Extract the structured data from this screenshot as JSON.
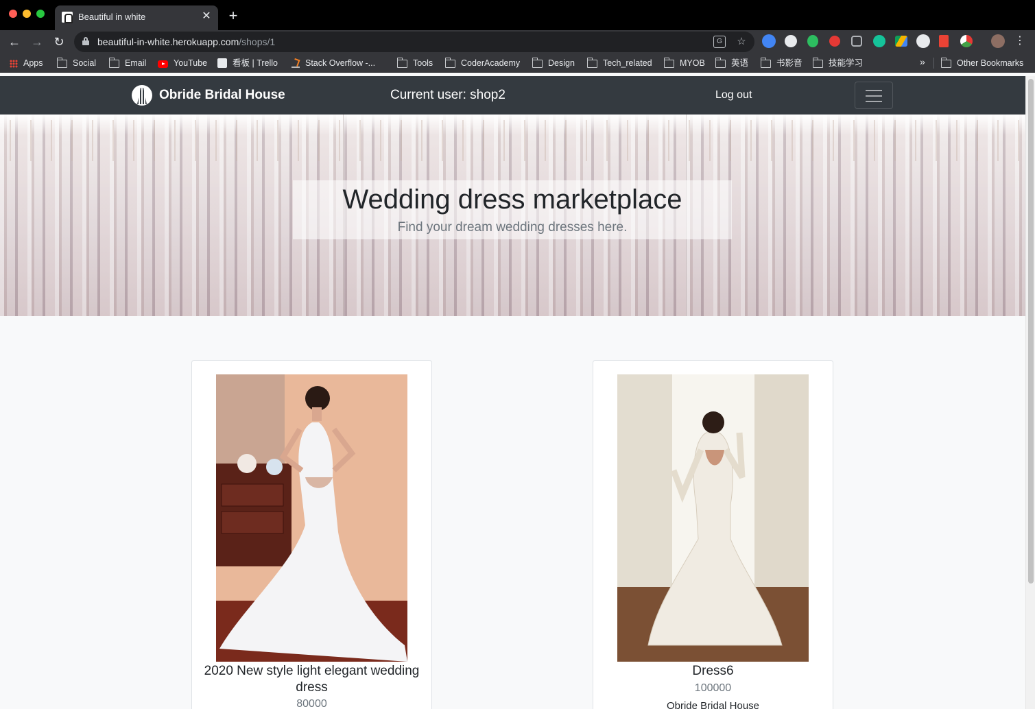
{
  "browser": {
    "tab_title": "Beautiful in white",
    "url_host": "beautiful-in-white.herokuapp.com",
    "url_path": "/shops/1",
    "bookmarks": [
      {
        "label": "Apps",
        "icon": "apps-icon"
      },
      {
        "label": "Social",
        "icon": "folder-icon"
      },
      {
        "label": "Email",
        "icon": "folder-icon"
      },
      {
        "label": "YouTube",
        "icon": "youtube-icon"
      },
      {
        "label": "看板 | Trello",
        "icon": "trello-icon"
      },
      {
        "label": "Stack Overflow -...",
        "icon": "stackoverflow-icon"
      },
      {
        "label": "Tools",
        "icon": "folder-icon"
      },
      {
        "label": "CoderAcademy",
        "icon": "folder-icon"
      },
      {
        "label": "Design",
        "icon": "folder-icon"
      },
      {
        "label": "Tech_related",
        "icon": "folder-icon"
      },
      {
        "label": "MYOB",
        "icon": "folder-icon"
      },
      {
        "label": "英语",
        "icon": "folder-icon"
      },
      {
        "label": "书影音",
        "icon": "folder-icon"
      },
      {
        "label": "技能学习",
        "icon": "folder-icon"
      }
    ],
    "other_bookmarks": "Other Bookmarks",
    "more_label": "»"
  },
  "site": {
    "brand": "Obride Bridal House",
    "current_user": "Current user: shop2",
    "logout": "Log out"
  },
  "hero": {
    "title": "Wedding dress marketplace",
    "subtitle": "Find your dream wedding dresses here."
  },
  "products": [
    {
      "title": "2020 New style light elegant wedding dress",
      "price": "80000"
    },
    {
      "title": "Dress6",
      "price": "100000",
      "shop": "Obride Bridal House"
    }
  ],
  "colors": {
    "navbar": "#343a40",
    "page_bg": "#f8f9fa",
    "muted_text": "#6c757d"
  }
}
